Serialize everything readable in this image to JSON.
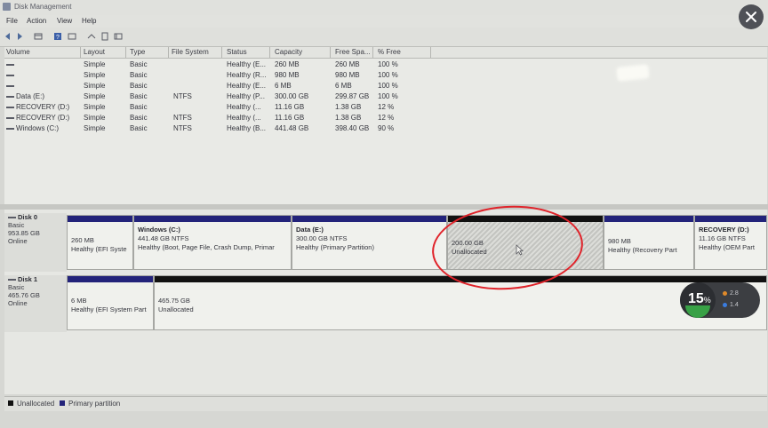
{
  "window": {
    "title": "Disk Management"
  },
  "menu": {
    "file": "File",
    "action": "Action",
    "view": "View",
    "help": "Help"
  },
  "toolbar": {
    "icons": [
      "back-icon",
      "forward-icon",
      "show-hide-icon",
      "help-icon",
      "properties-icon",
      "connect-icon",
      "refresh-icon",
      "list-icon"
    ]
  },
  "volume_table": {
    "headers": [
      "Volume",
      "Layout",
      "Type",
      "File System",
      "Status",
      "Capacity",
      "Free Spa...",
      "% Free"
    ],
    "rows": [
      {
        "volume": "",
        "layout": "Simple",
        "type": "Basic",
        "fs": "",
        "status": "Healthy (E...",
        "capacity": "260 MB",
        "free": "260 MB",
        "pct": "100 %"
      },
      {
        "volume": "",
        "layout": "Simple",
        "type": "Basic",
        "fs": "",
        "status": "Healthy (R...",
        "capacity": "980 MB",
        "free": "980 MB",
        "pct": "100 %"
      },
      {
        "volume": "",
        "layout": "Simple",
        "type": "Basic",
        "fs": "",
        "status": "Healthy (E...",
        "capacity": "6 MB",
        "free": "6 MB",
        "pct": "100 %"
      },
      {
        "volume": "Data (E:)",
        "layout": "Simple",
        "type": "Basic",
        "fs": "NTFS",
        "status": "Healthy (P...",
        "capacity": "300.00 GB",
        "free": "299.87 GB",
        "pct": "100 %"
      },
      {
        "volume": "RECOVERY (D:)",
        "layout": "Simple",
        "type": "Basic",
        "fs": "",
        "status": "Healthy (...",
        "capacity": "11.16 GB",
        "free": "1.38 GB",
        "pct": "12 %"
      },
      {
        "volume": "RECOVERY (D:)",
        "layout": "Simple",
        "type": "Basic",
        "fs": "NTFS",
        "status": "Healthy (...",
        "capacity": "11.16 GB",
        "free": "1.38 GB",
        "pct": "12 %"
      },
      {
        "volume": "Windows (C:)",
        "layout": "Simple",
        "type": "Basic",
        "fs": "NTFS",
        "status": "Healthy (B...",
        "capacity": "441.48 GB",
        "free": "398.40 GB",
        "pct": "90 %"
      }
    ]
  },
  "disks": [
    {
      "name": "Disk 0",
      "type": "Basic",
      "size": "953.85 GB",
      "state": "Online",
      "partitions": [
        {
          "title": "",
          "line1": "260 MB",
          "line2": "Healthy (EFI Syste"
        },
        {
          "title": "Windows (C:)",
          "line1": "441.48 GB NTFS",
          "line2": "Healthy (Boot, Page File, Crash Dump, Primar"
        },
        {
          "title": "Data (E:)",
          "line1": "300.00 GB NTFS",
          "line2": "Healthy (Primary Partition)"
        },
        {
          "title": "",
          "line1": "200.00 GB",
          "line2": "Unallocated"
        },
        {
          "title": "",
          "line1": "980 MB",
          "line2": "Healthy (Recovery Part"
        },
        {
          "title": "RECOVERY (D:)",
          "line1": "11.16 GB NTFS",
          "line2": "Healthy (OEM Part"
        }
      ]
    },
    {
      "name": "Disk 1",
      "type": "Basic",
      "size": "465.76 GB",
      "state": "Online",
      "partitions": [
        {
          "title": "",
          "line1": "6 MB",
          "line2": "Healthy (EFI System Part"
        },
        {
          "title": "",
          "line1": "465.75 GB",
          "line2": "Unallocated"
        }
      ]
    }
  ],
  "legend": {
    "unallocated": "Unallocated",
    "primary": "Primary partition"
  },
  "overlay": {
    "percent": "15",
    "percent_unit": "%",
    "stat1": "2.8",
    "stat2": "1.4"
  },
  "colors": {
    "primary": "#23237a",
    "unallocated": "#111111",
    "highlight": "#e0232a"
  }
}
